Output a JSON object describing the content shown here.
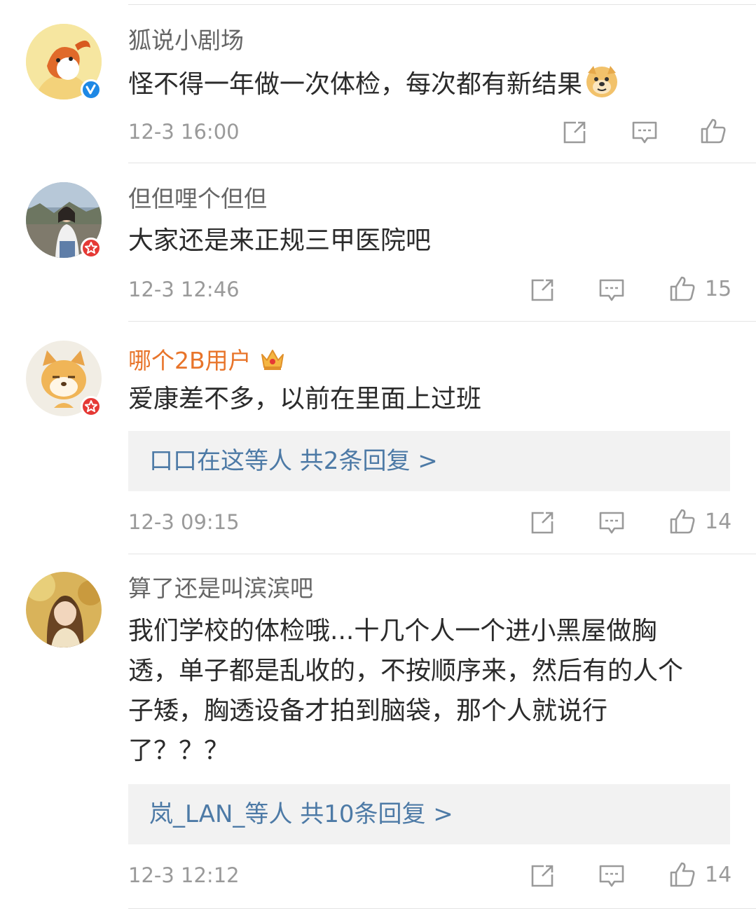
{
  "comments": [
    {
      "username": "狐说小剧场",
      "text_lines": [
        "怪不得一年做一次体检，每次都有新结果"
      ],
      "has_emoji": true,
      "emoji_icon": "doge-emoji-icon",
      "badge": "verified-v-icon",
      "time": "12-3 16:00",
      "likes": ""
    },
    {
      "username": "但但哩个但但",
      "text_lines": [
        "大家还是来正规三甲医院吧"
      ],
      "badge": "star-badge-icon",
      "time": "12-3 12:46",
      "likes": "15"
    },
    {
      "username": "哪个2B用户",
      "vip_crown": "crown-icon",
      "text_lines": [
        "爱康差不多，以前在里面上过班"
      ],
      "badge": "star-badge-icon",
      "replies": "口口在这等人  共2条回复 >",
      "time": "12-3 09:15",
      "likes": "14"
    },
    {
      "username": "算了还是叫滨滨吧",
      "text_lines": [
        "我们学校的体检哦...十几个人一个进小黑屋做胸",
        "透，单子都是乱收的，不按顺序来，然后有的人个",
        "子矮，胸透设备才拍到脑袋，那个人就说行",
        "了？？？"
      ],
      "replies": "岚_LAN_等人  共10条回复 >",
      "time": "12-3 12:12",
      "likes": "14"
    }
  ],
  "colors": {
    "username": "#666666",
    "vip_username": "#e8742a",
    "text": "#2b2b2b",
    "meta": "#9a9a9a",
    "reply_link": "#4d7aa6",
    "reply_bg": "#f2f2f2",
    "verified": "#1e88e5",
    "star_badge": "#e53935"
  },
  "action_icons": [
    "share-icon",
    "comment-icon",
    "like-icon"
  ]
}
